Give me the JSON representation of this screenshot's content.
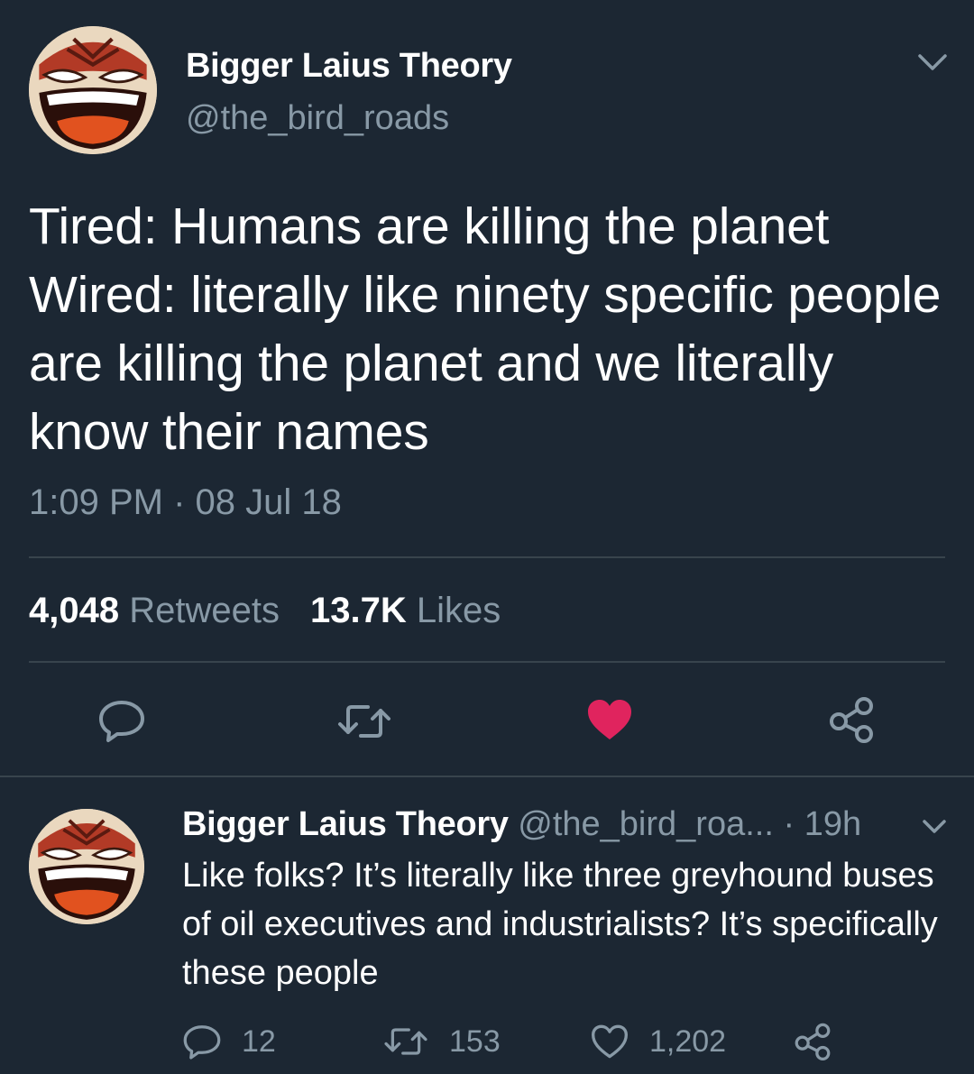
{
  "main_tweet": {
    "author_name": "Bigger Laius Theory",
    "author_handle": "@the_bird_roads",
    "text": "Tired: Humans are killing the planet\nWired: literally like ninety specific people are killing the planet and we literally know their names",
    "timestamp": "1:09 PM · 08 Jul 18",
    "retweets_count": "4,048",
    "retweets_label": "Retweets",
    "likes_count": "13.7K",
    "likes_label": "Likes",
    "liked": true,
    "icons": [
      "reply-icon",
      "retweet-icon",
      "heart-filled-icon",
      "share-icon",
      "chevron-down-icon"
    ]
  },
  "reply_tweet": {
    "author_name": "Bigger Laius Theory",
    "author_handle": "@the_bird_roa...",
    "separator": "·",
    "age": "19h",
    "text": "Like folks? It’s literally like three greyhound buses of oil executives and industrialists? It’s specifically these people",
    "reply_count": "12",
    "retweet_count": "153",
    "like_count": "1,202"
  },
  "colors": {
    "background": "#1c2733",
    "text_primary": "#ffffff",
    "text_secondary": "#8899a6",
    "divider": "#38444d",
    "like_active": "#e0245e"
  }
}
